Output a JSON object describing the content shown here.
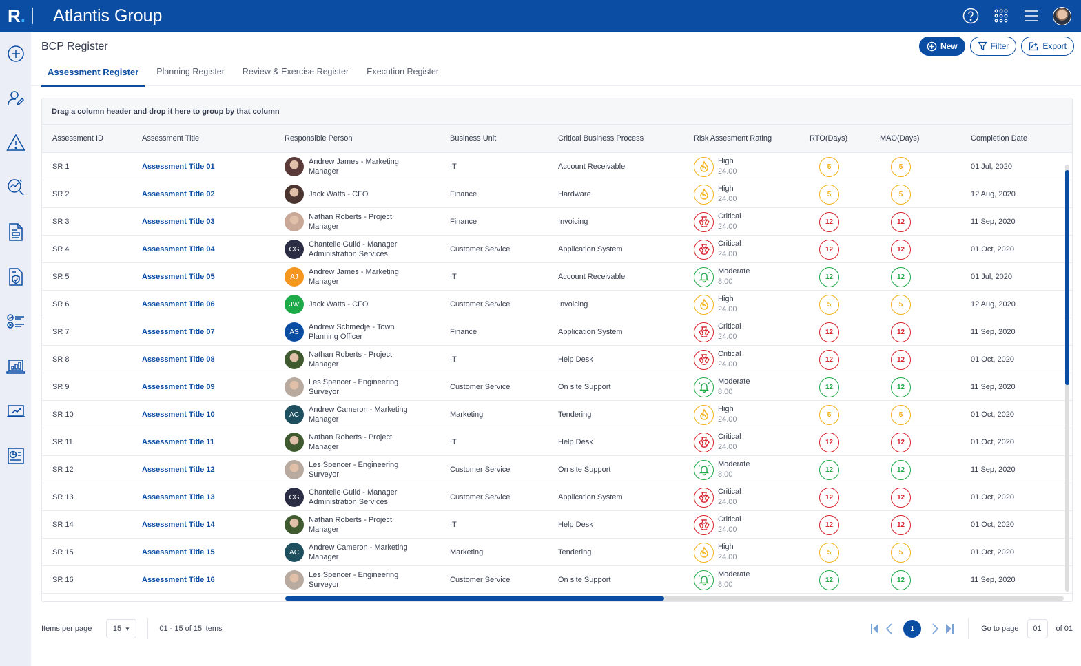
{
  "app": {
    "brand_letter": "R",
    "brand_dot": ".",
    "org_name": "Atlantis Group",
    "header_icons": [
      "help-icon",
      "apps-grid-icon",
      "menu-icon",
      "user-avatar"
    ]
  },
  "sidebar": {
    "items": [
      {
        "icon": "add-circle-icon",
        "label": "Add"
      },
      {
        "icon": "user-edit-icon",
        "label": "Users"
      },
      {
        "icon": "warning-icon",
        "label": "Risks"
      },
      {
        "icon": "analysis-search-icon",
        "label": "Analysis"
      },
      {
        "icon": "document-icon",
        "label": "Documents"
      },
      {
        "icon": "document-shield-icon",
        "label": "Policies"
      },
      {
        "icon": "checklist-icon",
        "label": "Checklists"
      },
      {
        "icon": "laptop-chart-icon",
        "label": "Dashboard"
      },
      {
        "icon": "trend-chart-icon",
        "label": "Trends"
      },
      {
        "icon": "report-icon",
        "label": "Reports"
      }
    ]
  },
  "page": {
    "title": "BCP Register",
    "actions": {
      "new": "New",
      "filter": "Filter",
      "export": "Export"
    },
    "tabs": [
      {
        "label": "Assessment Register",
        "active": true
      },
      {
        "label": "Planning Register",
        "active": false
      },
      {
        "label": "Review & Exercise Register",
        "active": false
      },
      {
        "label": "Execution Register",
        "active": false
      }
    ]
  },
  "grid": {
    "group_hint": "Drag a column header and drop it here to group by that column",
    "columns": [
      "Assessment ID",
      "Assessment Title",
      "Responsible Person",
      "Business Unit",
      "Critical Business Process",
      "Risk Assesment Rating",
      "RTO(Days)",
      "MAO(Days)",
      "Completion Date"
    ],
    "colors": {
      "high": "#f5b21b",
      "critical": "#d9232e",
      "moderate": "#1faa4a",
      "link": "#0a4da2"
    },
    "rows": [
      {
        "id": "SR 1",
        "title": "Assessment Title 01",
        "person": "Andrew James - Marketing Manager",
        "avatar": {
          "type": "photo",
          "color": "#5b3a3a"
        },
        "unit": "IT",
        "process": "Account Receivable",
        "rating": "High",
        "score": "24.00",
        "rto": "5",
        "mao": "5",
        "date": "01 Jul, 2020"
      },
      {
        "id": "SR 2",
        "title": "Assessment Title 02",
        "person": "Jack Watts - CFO",
        "avatar": {
          "type": "photo",
          "color": "#4a3530"
        },
        "unit": "Finance",
        "process": "Hardware",
        "rating": "High",
        "score": "24.00",
        "rto": "5",
        "mao": "5",
        "date": "12 Aug, 2020"
      },
      {
        "id": "SR 3",
        "title": "Assessment Title 03",
        "person": "Nathan Roberts - Project Manager",
        "avatar": {
          "type": "photo",
          "color": "#c9a898"
        },
        "unit": "Finance",
        "process": "Invoicing",
        "rating": "Critical",
        "score": "24.00",
        "rto": "12",
        "mao": "12",
        "date": "11 Sep, 2020"
      },
      {
        "id": "SR 4",
        "title": "Assessment Title 04",
        "person": "Chantelle Guild - Manager Administration Services",
        "avatar": {
          "type": "initials",
          "initials": "CG",
          "color": "#2b2d45"
        },
        "unit": "Customer Service",
        "process": "Application System",
        "rating": "Critical",
        "score": "24.00",
        "rto": "12",
        "mao": "12",
        "date": "01 Oct, 2020"
      },
      {
        "id": "SR 5",
        "title": "Assessment Title 05",
        "person": "Andrew James - Marketing Manager",
        "avatar": {
          "type": "initials",
          "initials": "AJ",
          "color": "#f5961e"
        },
        "unit": "IT",
        "process": "Account Receivable",
        "rating": "Moderate",
        "score": "8.00",
        "rto": "12",
        "mao": "12",
        "date": "01 Jul, 2020"
      },
      {
        "id": "SR 6",
        "title": "Assessment Title 06",
        "person": "Jack Watts - CFO",
        "avatar": {
          "type": "initials",
          "initials": "JW",
          "color": "#1faa4a"
        },
        "unit": "Customer Service",
        "process": "Invoicing",
        "rating": "High",
        "score": "24.00",
        "rto": "5",
        "mao": "5",
        "date": "12 Aug, 2020"
      },
      {
        "id": "SR 7",
        "title": "Assessment Title 07",
        "person": "Andrew Schmedje - Town Planning Officer",
        "avatar": {
          "type": "initials",
          "initials": "AS",
          "color": "#0a4da2"
        },
        "unit": "Finance",
        "process": "Application System",
        "rating": "Critical",
        "score": "24.00",
        "rto": "12",
        "mao": "12",
        "date": "11 Sep, 2020"
      },
      {
        "id": "SR 8",
        "title": "Assessment Title 08",
        "person": "Nathan Roberts - Project Manager",
        "avatar": {
          "type": "photo",
          "color": "#3f5a2e"
        },
        "unit": "IT",
        "process": "Help Desk",
        "rating": "Critical",
        "score": "24.00",
        "rto": "12",
        "mao": "12",
        "date": "01 Oct, 2020"
      },
      {
        "id": "SR 9",
        "title": "Assessment Title 09",
        "person": "Les Spencer - Engineering Surveyor",
        "avatar": {
          "type": "photo",
          "color": "#b9aaa0"
        },
        "unit": "Customer Service",
        "process": "On site Support",
        "rating": "Moderate",
        "score": "8.00",
        "rto": "12",
        "mao": "12",
        "date": "11 Sep, 2020"
      },
      {
        "id": "SR 10",
        "title": "Assessment Title 10",
        "person": "Andrew Cameron - Marketing Manager",
        "avatar": {
          "type": "initials",
          "initials": "AC",
          "color": "#1e4f5e"
        },
        "unit": "Marketing",
        "process": "Tendering",
        "rating": "High",
        "score": "24.00",
        "rto": "5",
        "mao": "5",
        "date": "01 Oct, 2020"
      },
      {
        "id": "SR 11",
        "title": "Assessment Title 11",
        "person": "Nathan Roberts - Project Manager",
        "avatar": {
          "type": "photo",
          "color": "#3f5a2e"
        },
        "unit": "IT",
        "process": "Help Desk",
        "rating": "Critical",
        "score": "24.00",
        "rto": "12",
        "mao": "12",
        "date": "01 Oct, 2020"
      },
      {
        "id": "SR 12",
        "title": "Assessment Title 12",
        "person": "Les Spencer - Engineering Surveyor",
        "avatar": {
          "type": "photo",
          "color": "#b9aaa0"
        },
        "unit": "Customer Service",
        "process": "On site Support",
        "rating": "Moderate",
        "score": "8.00",
        "rto": "12",
        "mao": "12",
        "date": "11 Sep, 2020"
      },
      {
        "id": "SR 13",
        "title": "Assessment Title 13",
        "person": "Chantelle Guild - Manager Administration Services",
        "avatar": {
          "type": "initials",
          "initials": "CG",
          "color": "#2b2d45"
        },
        "unit": "Customer Service",
        "process": "Application System",
        "rating": "Critical",
        "score": "24.00",
        "rto": "12",
        "mao": "12",
        "date": "01 Oct, 2020"
      },
      {
        "id": "SR 14",
        "title": "Assessment Title 14",
        "person": "Nathan Roberts - Project Manager",
        "avatar": {
          "type": "photo",
          "color": "#3f5a2e"
        },
        "unit": "IT",
        "process": "Help Desk",
        "rating": "Critical",
        "score": "24.00",
        "rto": "12",
        "mao": "12",
        "date": "01 Oct, 2020"
      },
      {
        "id": "SR 15",
        "title": "Assessment Title 15",
        "person": "Andrew Cameron - Marketing Manager",
        "avatar": {
          "type": "initials",
          "initials": "AC",
          "color": "#1e4f5e"
        },
        "unit": "Marketing",
        "process": "Tendering",
        "rating": "High",
        "score": "24.00",
        "rto": "5",
        "mao": "5",
        "date": "01 Oct, 2020"
      },
      {
        "id": "SR 16",
        "title": "Assessment Title 16",
        "person": "Les Spencer - Engineering Surveyor",
        "avatar": {
          "type": "photo",
          "color": "#b9aaa0"
        },
        "unit": "Customer Service",
        "process": "On site Support",
        "rating": "Moderate",
        "score": "8.00",
        "rto": "12",
        "mao": "12",
        "date": "11 Sep, 2020"
      }
    ]
  },
  "footer": {
    "items_per_page_label": "Items per page",
    "items_per_page_value": "15",
    "range_text": "01 - 15 of 15 items",
    "current_page": "1",
    "goto_label": "Go to page",
    "goto_value": "01",
    "total_pages_text": "of 01"
  }
}
